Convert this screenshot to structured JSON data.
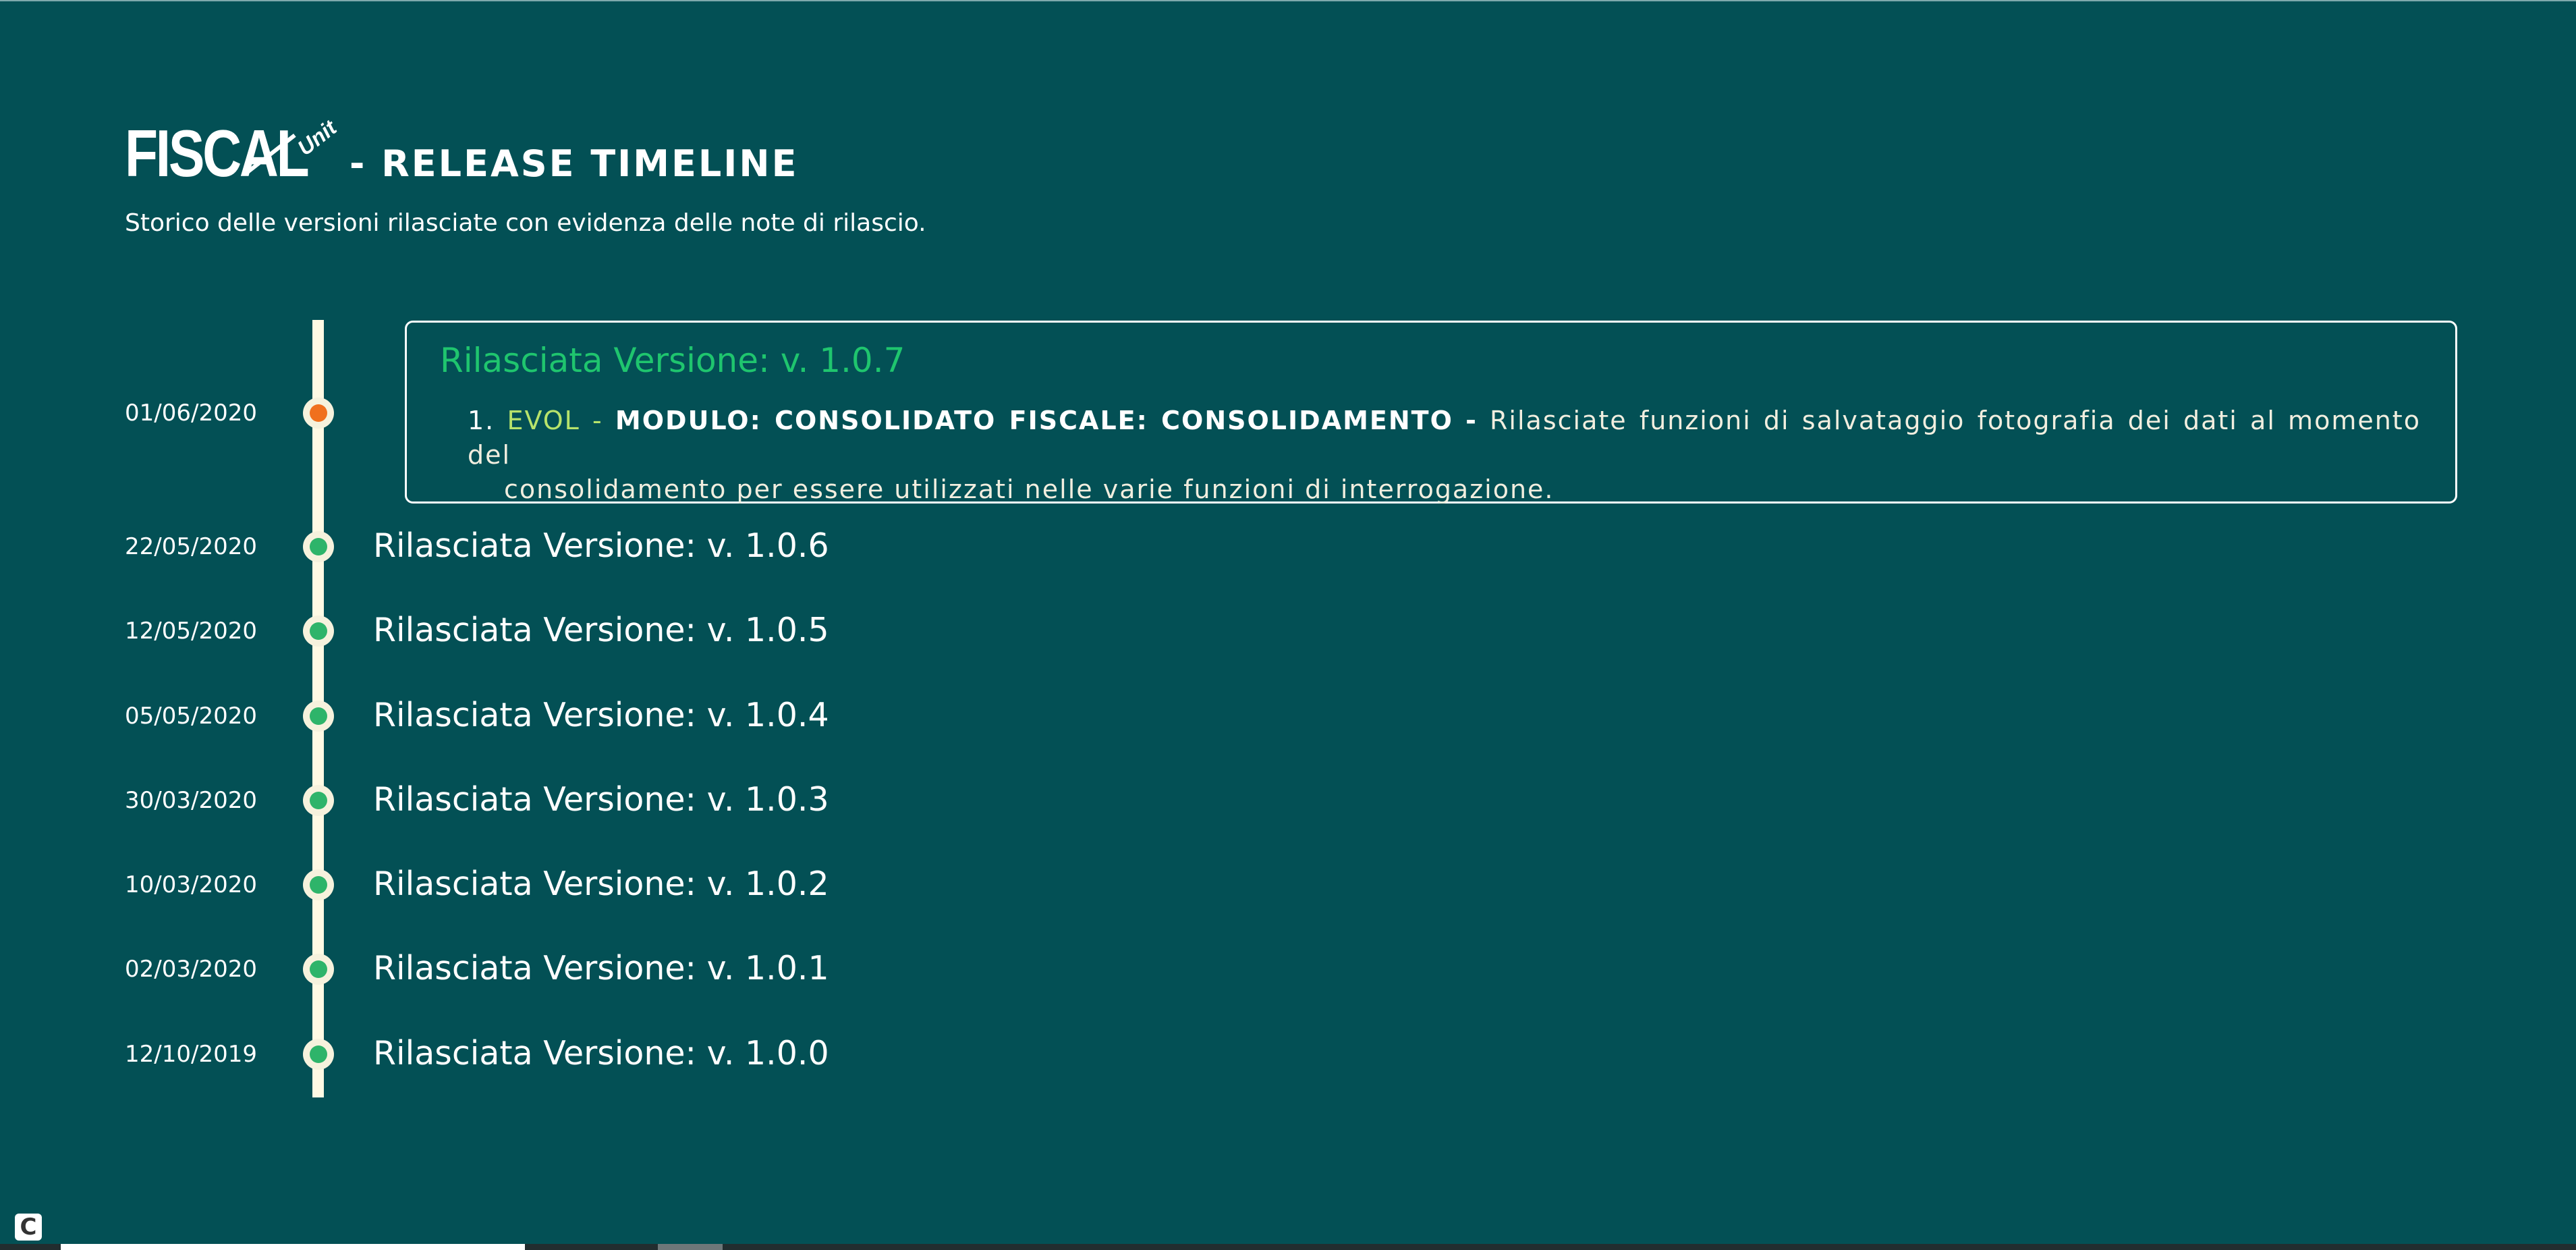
{
  "header": {
    "logo_text": "FISCAL",
    "logo_sub": "Unit",
    "title": "- RELEASE TIMELINE",
    "subtitle": "Storico delle versioni rilasciate con evidenza delle note di rilascio."
  },
  "timeline": [
    {
      "date": "01/06/2020",
      "label": "Rilasciata Versione: v. 1.0.7",
      "expanded": true,
      "status_color": "#f0701e",
      "notes": [
        {
          "number": "1.",
          "tag": "EVOL",
          "sep1": "-",
          "module": "MODULO: CONSOLIDATO FISCALE: CONSOLIDAMENTO",
          "sep2": "-",
          "text_line1": "Rilasciate funzioni di salvataggio fotografia dei dati al momento del",
          "text_line2": "consolidamento per essere utilizzati nelle varie funzioni di interrogazione."
        }
      ]
    },
    {
      "date": "22/05/2020",
      "label": "Rilasciata Versione: v. 1.0.6",
      "status_color": "#2eb46a"
    },
    {
      "date": "12/05/2020",
      "label": "Rilasciata Versione: v. 1.0.5",
      "status_color": "#2eb46a"
    },
    {
      "date": "05/05/2020",
      "label": "Rilasciata Versione: v. 1.0.4",
      "status_color": "#2eb46a"
    },
    {
      "date": "30/03/2020",
      "label": "Rilasciata Versione: v. 1.0.3",
      "status_color": "#2eb46a"
    },
    {
      "date": "10/03/2020",
      "label": "Rilasciata Versione: v. 1.0.2",
      "status_color": "#2eb46a"
    },
    {
      "date": "02/03/2020",
      "label": "Rilasciata Versione: v. 1.0.1",
      "status_color": "#2eb46a"
    },
    {
      "date": "12/10/2019",
      "label": "Rilasciata Versione: v. 1.0.0",
      "status_color": "#2eb46a"
    }
  ],
  "footer": {
    "corner_icon_letter": "C"
  },
  "colors": {
    "background": "#035055",
    "accent_green": "#1fc56e",
    "evol_green": "#b7e36b",
    "timeline_line": "#fffae4"
  }
}
